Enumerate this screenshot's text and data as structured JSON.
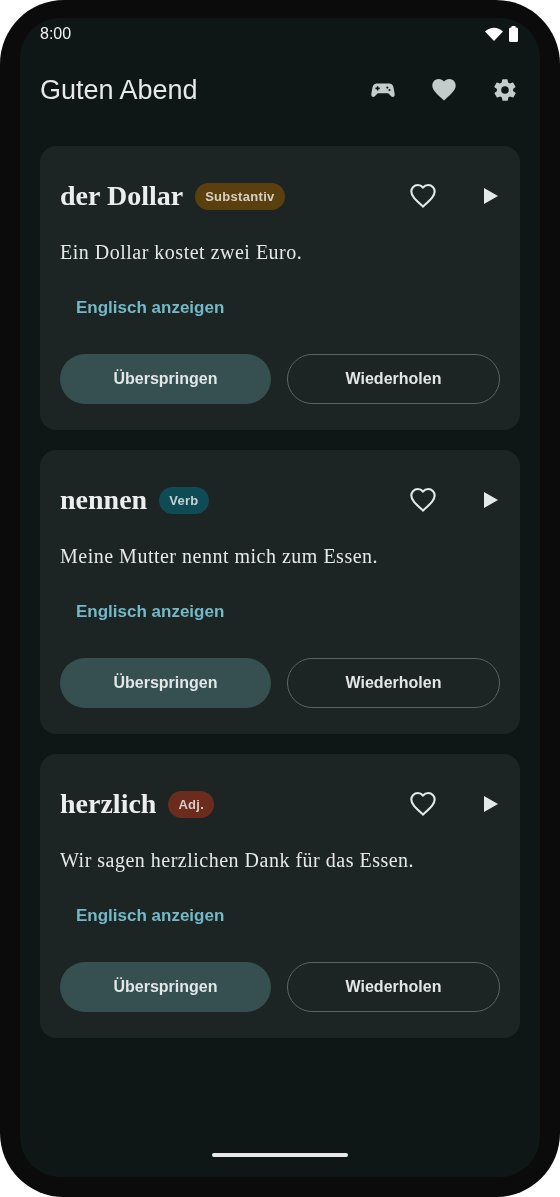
{
  "status_bar": {
    "time": "8:00"
  },
  "header": {
    "title": "Guten Abend"
  },
  "cards": [
    {
      "word": "der Dollar",
      "tag": {
        "label": "Substantiv",
        "color": "#5a400f"
      },
      "favorite": false,
      "sentence": "Ein Dollar kostet zwei Euro.",
      "link": "Englisch anzeigen",
      "buttons": [
        {
          "label": "Überspringen",
          "kind": "filled"
        },
        {
          "label": "Wiederholen",
          "kind": "outlined"
        }
      ]
    },
    {
      "word": "nennen",
      "tag": {
        "label": "Verb",
        "color": "#0f4b55"
      },
      "favorite": false,
      "sentence": "Meine Mutter nennt mich zum Essen.",
      "link": "Englisch anzeigen",
      "buttons": [
        {
          "label": "Überspringen",
          "kind": "filled"
        },
        {
          "label": "Wiederholen",
          "kind": "outlined"
        }
      ]
    },
    {
      "word": "herzlich",
      "tag": {
        "label": "Adj.",
        "color": "#6b2b1d"
      },
      "favorite": false,
      "sentence": "Wir sagen herzlichen Dank für das Essen.",
      "link": "Englisch anzeigen",
      "buttons": [
        {
          "label": "Überspringen",
          "kind": "filled"
        },
        {
          "label": "Wiederholen",
          "kind": "outlined"
        }
      ]
    }
  ]
}
